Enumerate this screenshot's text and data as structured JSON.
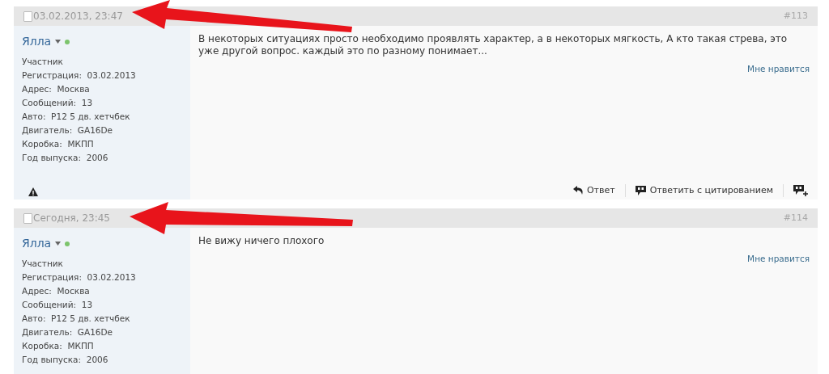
{
  "posts": [
    {
      "checked": false,
      "date": "03.02.2013, 23:47",
      "number": "#113",
      "author": "Ялла",
      "online": true,
      "role": "Участник",
      "details": [
        {
          "label": "Регистрация:",
          "value": "03.02.2013"
        },
        {
          "label": "Адрес:",
          "value": "Москва"
        },
        {
          "label": "Сообщений:",
          "value": "13"
        },
        {
          "label": "Авто:",
          "value": "P12 5 дв. хетчбек"
        },
        {
          "label": "Двигатель:",
          "value": "GA16De"
        },
        {
          "label": "Коробка:",
          "value": "МКПП"
        },
        {
          "label": "Год выпуска:",
          "value": "2006"
        }
      ],
      "message": "В некоторых ситуациях просто необходимо проявлять характер, а в некоторых мягкость, А кто такая стрева, это уже другой вопрос. каждый это по разному понимает...",
      "like": "Мне нравится",
      "footer": {
        "reply": "Ответ",
        "quote": "Ответить с цитированием"
      }
    },
    {
      "checked": false,
      "date": "Сегодня, 23:45",
      "number": "#114",
      "author": "Ялла",
      "online": true,
      "role": "Участник",
      "details": [
        {
          "label": "Регистрация:",
          "value": "03.02.2013"
        },
        {
          "label": "Адрес:",
          "value": "Москва"
        },
        {
          "label": "Сообщений:",
          "value": "13"
        },
        {
          "label": "Авто:",
          "value": "P12 5 дв. хетчбек"
        },
        {
          "label": "Двигатель:",
          "value": "GA16De"
        },
        {
          "label": "Коробка:",
          "value": "МКПП"
        },
        {
          "label": "Год выпуска:",
          "value": "2006"
        }
      ],
      "message": "Не вижу ничего плохого",
      "like": "Мне нравится"
    }
  ]
}
